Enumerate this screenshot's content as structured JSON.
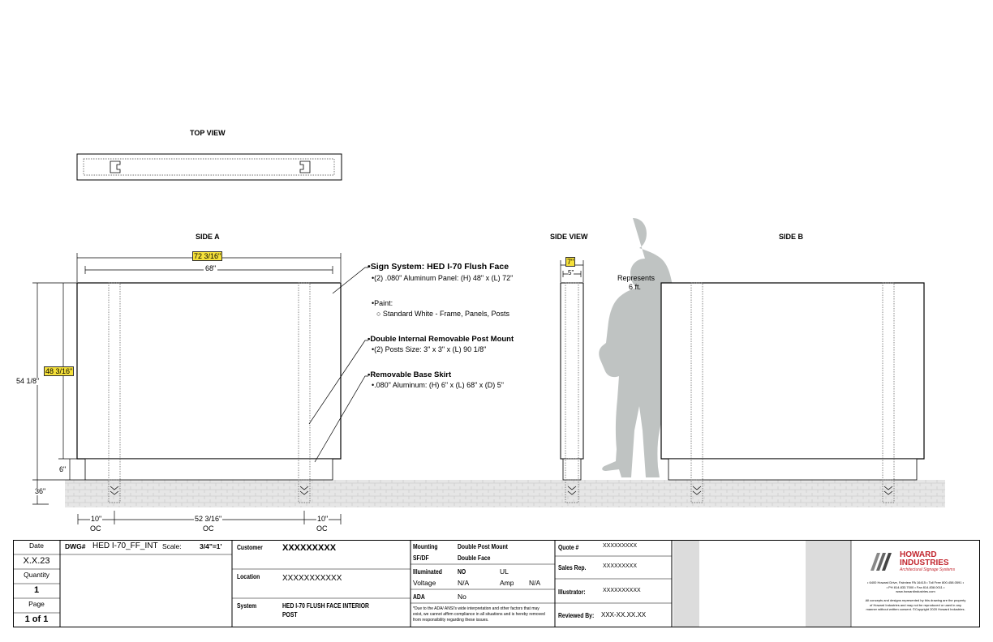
{
  "views": {
    "top": "TOP VIEW",
    "side_a": "SIDE A",
    "side_view": "SIDE VIEW",
    "side_b": "SIDE B"
  },
  "dimensions": {
    "overall_width": "72 3/16\"",
    "inner_width": "68\"",
    "panel_height": "48 3/16\"",
    "total_height": "54 1/8\"",
    "skirt_height": "6\"",
    "bury_depth": "36\"",
    "oc_left": "10\"",
    "oc_mid": "52 3/16\"",
    "oc_right": "10\"",
    "oc_label": "OC",
    "side_depth": "7\"",
    "side_inner": "5\""
  },
  "human": {
    "line1": "Represents",
    "line2": "6 ft."
  },
  "notes": [
    {
      "title": "Sign System: HED I-70 Flush Face",
      "lines": [
        "•(2) .080\" Aluminum Panel: (H) 48\" x (L) 72\""
      ]
    },
    {
      "title": "•Paint:",
      "lines": [
        "○ Standard White - Frame, Panels, Posts"
      ]
    },
    {
      "title": "•Double Internal Removable Post Mount",
      "lines": [
        "•(2) Posts Size: 3\" x 3\" x (L) 90 1/8\""
      ]
    },
    {
      "title": "•Removable Base Skirt",
      "lines": [
        "•.080\" Aluminum: (H) 6\" x (L) 68\" x (D) 5\""
      ]
    }
  ],
  "title_block": {
    "date_label": "Date",
    "date_value": "X.X.23",
    "quantity_label": "Quantity",
    "quantity_value": "1",
    "page_label": "Page",
    "page_value": "1 of 1",
    "dwg_label": "DWG#",
    "dwg_value": "HED I-70_FF_INT",
    "scale_label": "Scale:",
    "scale_value": "3/4\"=1'",
    "customer_label": "Customer",
    "customer_value": "XXXXXXXXX",
    "location_label": "Location",
    "location_value": "XXXXXXXXXXX",
    "system_label": "System",
    "system_value_1": "HED I-70 FLUSH FACE INTERIOR",
    "system_value_2": "POST",
    "mounting_label": "Mounting",
    "mounting_value": "Double Post Mount",
    "sfdf_label": "SF/DF",
    "sfdf_value": "Double Face",
    "illuminated_label": "Illuminated",
    "illuminated_value": "NO",
    "ul_label": "UL",
    "voltage_label": "Voltage",
    "voltage_value": "N/A",
    "amp_label": "Amp",
    "amp_value": "N/A",
    "ada_label": "ADA",
    "ada_value": "No",
    "disclaimer_1": "*Due to the ADA/ ANSI's wide interpretation and other factors that may",
    "disclaimer_2": "exist, we cannot affirm compliance in all situations and is hereby removed",
    "disclaimer_3": "from responsibility regarding these issues.",
    "quote_label": "Quote #",
    "quote_value": "XXXXXXXXX",
    "sales_label": "Sales Rep.",
    "sales_value": "XXXXXXXXX",
    "illustrator_label": "Illustrator:",
    "illustrator_value": "XXXXXXXXXX",
    "reviewed_label": "Reviewed By:",
    "reviewed_value": "XXX-XX.XX.XX"
  },
  "company": {
    "name_1": "HOWARD",
    "name_2": "INDUSTRIES",
    "tagline": "Architectural Signage Systems",
    "address_1": "• 6400 Howard Drive, Fairview PA 16415 • Toll Free 800.458.0591 •",
    "address_2": "• PH 814.833.7000 • Fax 814.838.0011 •",
    "website": "www.howardindustries.com",
    "legal_1": "All concepts and designs represented by this drawing are the property",
    "legal_2": "of Howard Industries and may not be reproduced or used in any",
    "legal_3": "manner without written consent. ©Copyright 2020 Howard Industries."
  },
  "colors": {
    "highlight": "#f5e03a",
    "human": "#bfc3c2",
    "ground": "#e2e2e2",
    "gray_cell": "#dcdcdc",
    "logo_red": "#c2262e"
  }
}
